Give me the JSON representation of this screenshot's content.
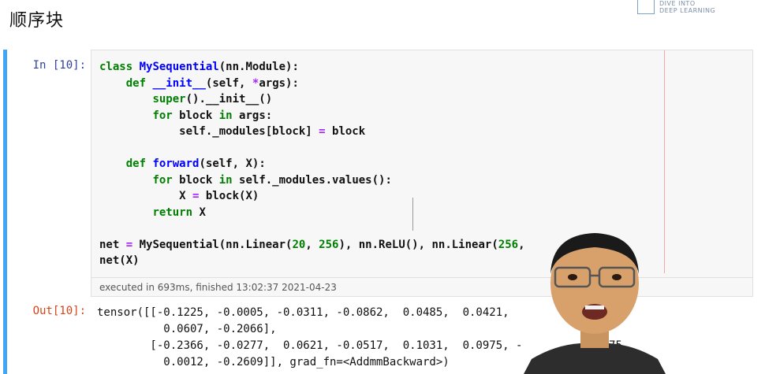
{
  "slide": {
    "title": "顺序块"
  },
  "logo": {
    "line1": "DIVE INTO",
    "line2": "DEEP LEARNING"
  },
  "cell": {
    "in_prompt": "In [10]:",
    "out_prompt": "Out[10]:",
    "executed_text": "executed in 693ms, finished 13:02:37 2021-04-23",
    "code_lines": [
      "class MySequential(nn.Module):",
      "    def __init__(self, *args):",
      "        super().__init__()",
      "        for block in args:",
      "            self._modules[block] = block",
      "",
      "    def forward(self, X):",
      "        for block in self._modules.values():",
      "            X = block(X)",
      "        return X",
      "",
      "net = MySequential(nn.Linear(20, 256), nn.ReLU(), nn.Linear(256,",
      "net(X)"
    ],
    "output_lines": [
      "tensor([[-0.1225, -0.0005, -0.0311, -0.0862,  0.0485,  0.0421,          0.0057,",
      "          0.0607, -0.2066],",
      "        [-0.2366, -0.0277,  0.0621, -0.0517,  0.1031,  0.0975, -         0.1175,",
      "          0.0012, -0.2609]], grad_fn=<AddmmBackward>)"
    ]
  },
  "colors": {
    "in_prompt": "#303f9f",
    "out_prompt": "#d84315",
    "cell_border": "#42a5f5",
    "keyword": "#008000",
    "name": "#0000ff",
    "operator": "#aa22ff"
  },
  "presenter": {
    "description_icon": "presenter-video-icon"
  }
}
